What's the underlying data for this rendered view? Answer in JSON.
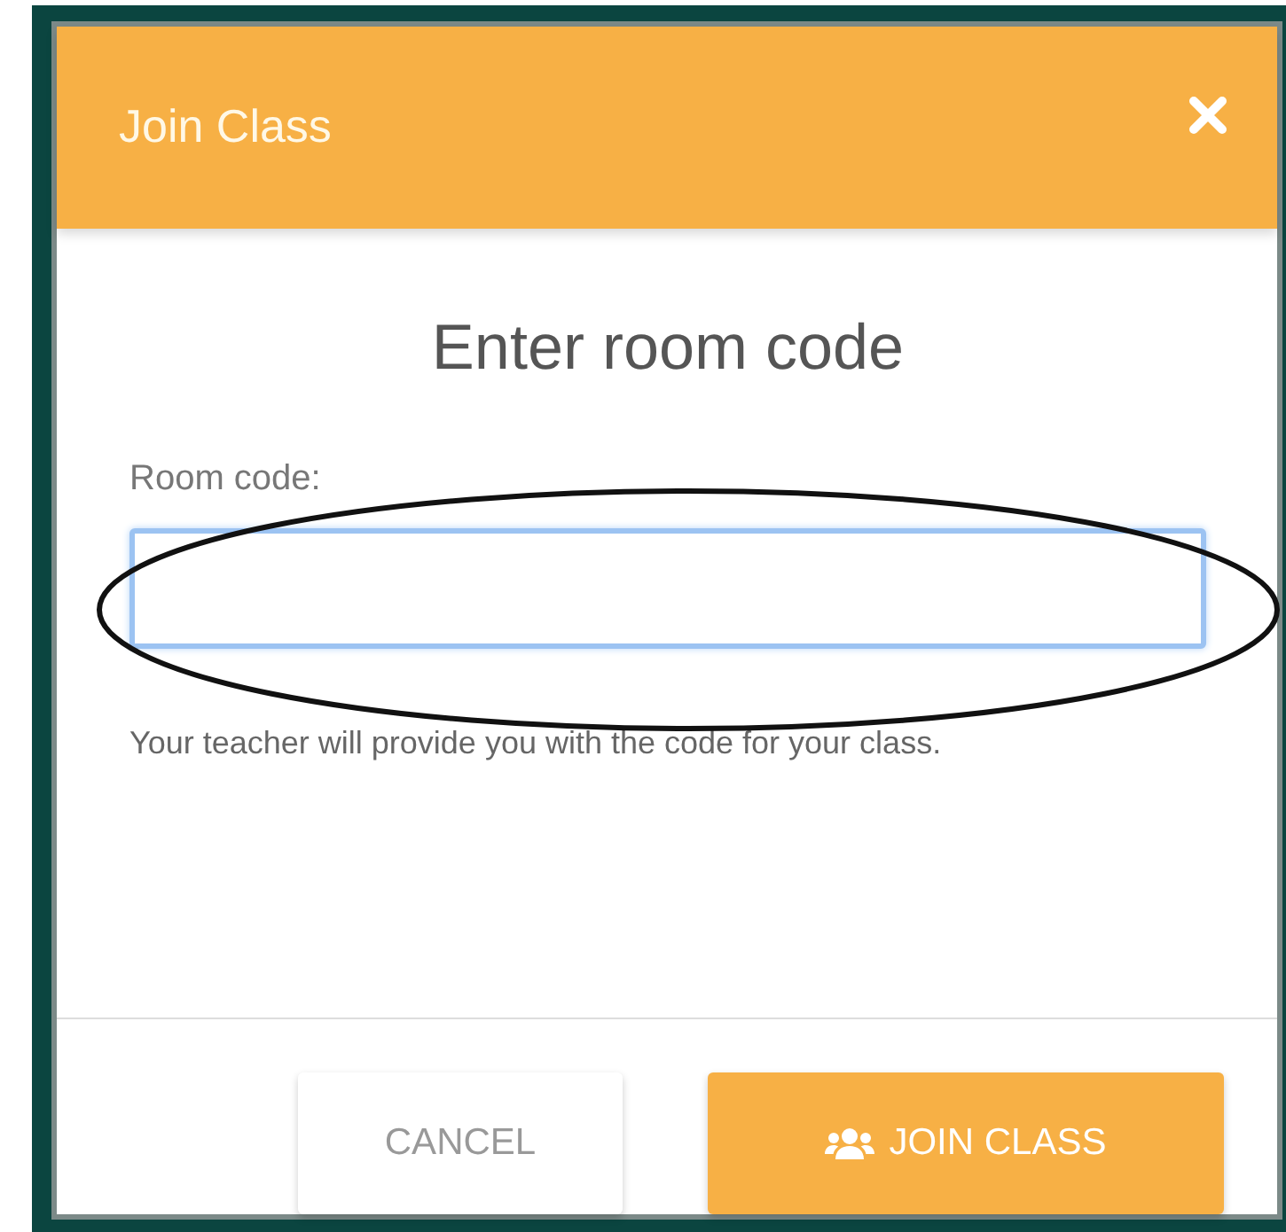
{
  "dialog": {
    "title": "Join Class",
    "heading": "Enter room code",
    "field": {
      "label": "Room code:",
      "focused": true
    },
    "hint": "Your teacher will provide you with the code for your class.",
    "buttons": [
      {
        "kind": "secondary",
        "label": "CANCEL"
      },
      {
        "kind": "primary",
        "label": "JOIN CLASS"
      }
    ],
    "annotation": {
      "kind": "ellipse"
    }
  }
}
